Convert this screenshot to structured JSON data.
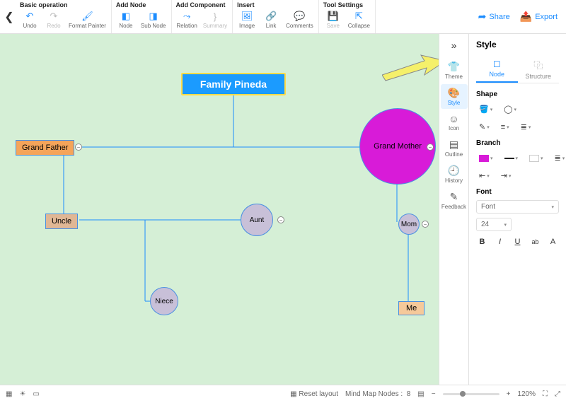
{
  "toolbar": {
    "groups": {
      "basic": {
        "title": "Basic operation",
        "undo": "Undo",
        "redo": "Redo",
        "format_painter": "Format Painter"
      },
      "add_node": {
        "title": "Add Node",
        "node": "Node",
        "sub_node": "Sub Node"
      },
      "add_component": {
        "title": "Add Component",
        "relation": "Relation",
        "summary": "Summary"
      },
      "insert": {
        "title": "Insert",
        "image": "Image",
        "link": "Link",
        "comments": "Comments"
      },
      "tool_settings": {
        "title": "Tool Settings",
        "save": "Save",
        "collapse": "Collapse"
      }
    },
    "share": "Share",
    "export": "Export"
  },
  "canvas": {
    "root": "Family Pineda",
    "grand_father": "Grand Father",
    "grand_mother": "Grand Mother",
    "uncle": "Uncle",
    "aunt": "Aunt",
    "mom": "Mom",
    "niece": "Niece",
    "me": "Me"
  },
  "right_col": {
    "theme": "Theme",
    "style": "Style",
    "icon": "Icon",
    "outline": "Outline",
    "history": "History",
    "feedback": "Feedback"
  },
  "panel": {
    "title": "Style",
    "tabs": {
      "node": "Node",
      "structure": "Structure"
    },
    "shape": "Shape",
    "branch": "Branch",
    "font": "Font",
    "font_sel": "Font",
    "size": "24"
  },
  "status": {
    "reset": "Reset layout",
    "nodes_label": "Mind Map Nodes :",
    "nodes_count": "8",
    "zoom": "120%"
  }
}
